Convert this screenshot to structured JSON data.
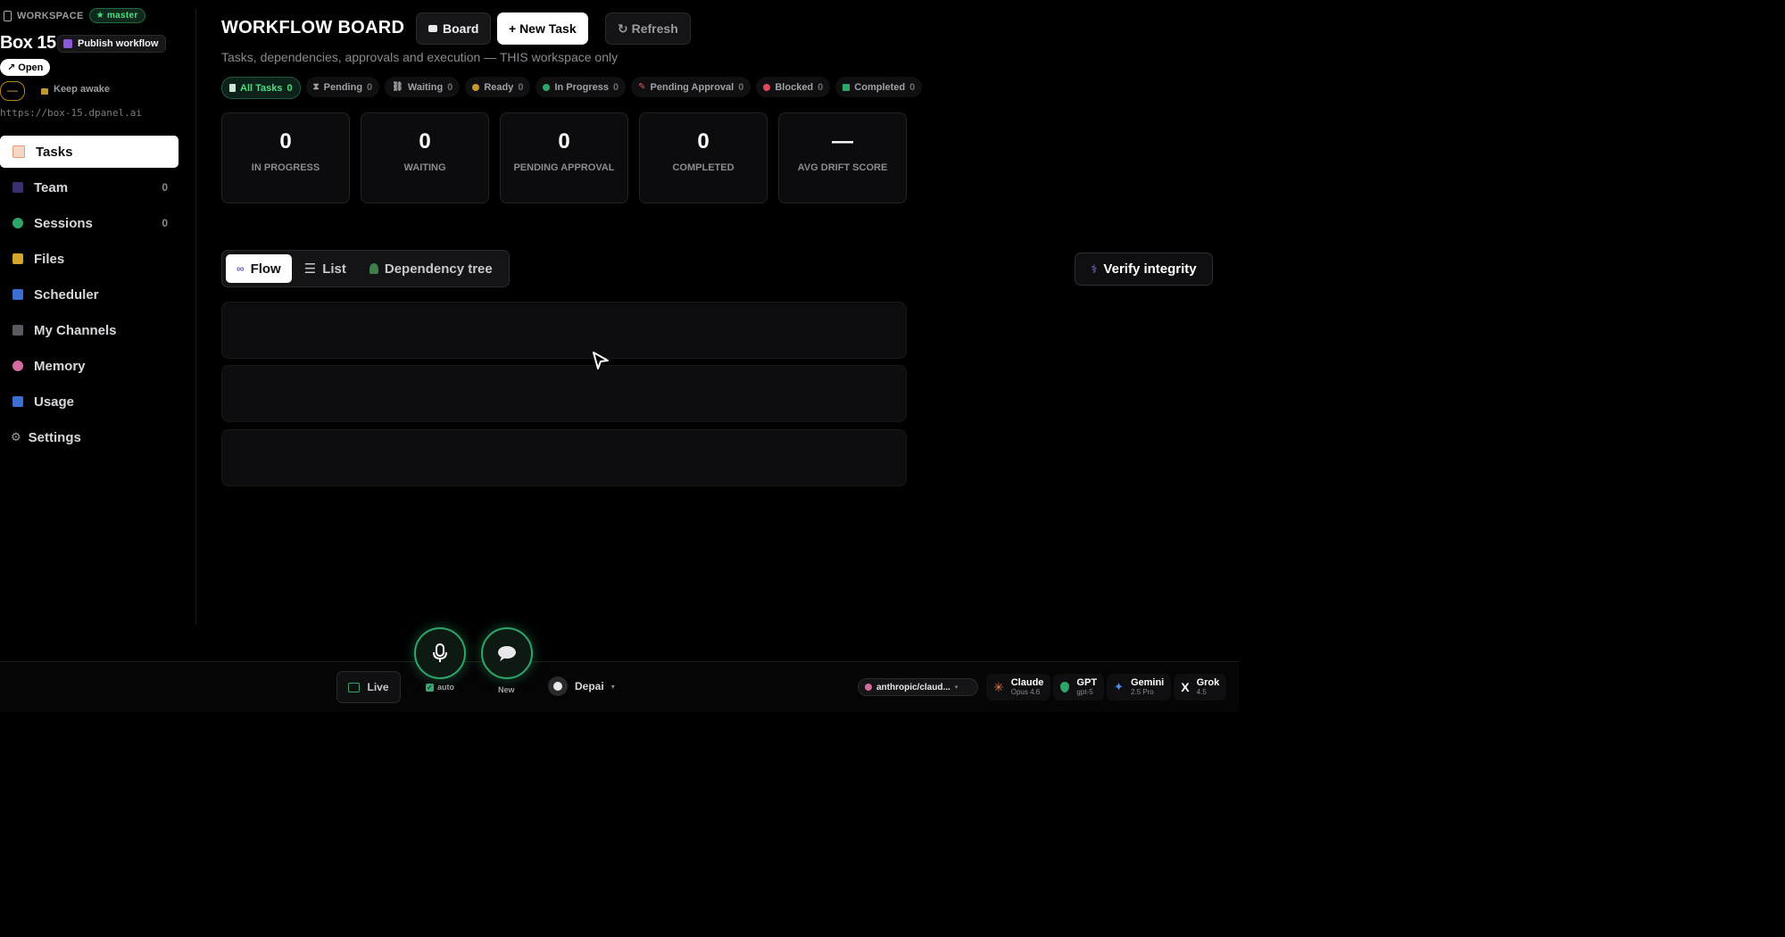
{
  "workspace": {
    "label": "WORKSPACE",
    "branch": "★ master",
    "box_name": "Box 15",
    "publish_label": "Publish workflow",
    "open_label": "↗ Open",
    "dash_label": "—",
    "keep_awake_label": "Keep awake",
    "url": "https://box-15.dpanel.ai"
  },
  "sidebar": {
    "items": [
      {
        "label": "Tasks",
        "count": "",
        "icon": "clipboard-icon",
        "color": "#e89a6a"
      },
      {
        "label": "Team",
        "count": "0",
        "icon": "people-icon",
        "color": "#6b5bc4"
      },
      {
        "label": "Sessions",
        "count": "0",
        "icon": "green-circle-icon",
        "color": "#2ea66a"
      },
      {
        "label": "Files",
        "count": "",
        "icon": "folder-icon",
        "color": "#d4a52a"
      },
      {
        "label": "Scheduler",
        "count": "",
        "icon": "calendar-icon",
        "color": "#3b6fd4"
      },
      {
        "label": "My Channels",
        "count": "",
        "icon": "satellite-icon",
        "color": "#8a8a90"
      },
      {
        "label": "Memory",
        "count": "",
        "icon": "brain-icon",
        "color": "#d46aa0"
      },
      {
        "label": "Usage",
        "count": "",
        "icon": "bar-chart-icon",
        "color": "#3b6fd4"
      },
      {
        "label": "Settings",
        "count": "",
        "icon": "gear-icon",
        "color": "#a0a0a6"
      }
    ]
  },
  "header": {
    "title": "WORKFLOW BOARD",
    "board_label": "Board",
    "new_task_label": "+ New Task",
    "refresh_label": "↻ Refresh",
    "subtitle": "Tasks, dependencies, approvals and execution — THIS workspace only"
  },
  "filters": [
    {
      "label": "All Tasks",
      "count": "0",
      "icon": "clipboard-icon",
      "color": "#4ade80"
    },
    {
      "label": "Pending",
      "count": "0",
      "icon": "hourglass-icon",
      "color": "#a0a0a6"
    },
    {
      "label": "Waiting",
      "count": "0",
      "icon": "link-icon",
      "color": "#a0a0a6"
    },
    {
      "label": "Ready",
      "count": "0",
      "icon": "yellow-circle-icon",
      "color": "#d4a52a"
    },
    {
      "label": "In Progress",
      "count": "0",
      "icon": "green-circle-icon",
      "color": "#2ea66a"
    },
    {
      "label": "Pending Approval",
      "count": "0",
      "icon": "pin-icon",
      "color": "#e05a5a"
    },
    {
      "label": "Blocked",
      "count": "0",
      "icon": "no-entry-icon",
      "color": "#e04a5a"
    },
    {
      "label": "Completed",
      "count": "0",
      "icon": "check-box-icon",
      "color": "#2ea66a"
    }
  ],
  "stats": [
    {
      "value": "0",
      "label": "IN PROGRESS"
    },
    {
      "value": "0",
      "label": "WAITING"
    },
    {
      "value": "0",
      "label": "PENDING APPROVAL"
    },
    {
      "value": "0",
      "label": "COMPLETED"
    },
    {
      "value": "—",
      "label": "AVG DRIFT SCORE"
    }
  ],
  "views": {
    "tabs": [
      {
        "label": "Flow",
        "icon": "flow-icon"
      },
      {
        "label": "List",
        "icon": "list-icon"
      },
      {
        "label": "Dependency tree",
        "icon": "tree-icon"
      }
    ],
    "verify_label": "Verify integrity"
  },
  "bottom": {
    "live_label": "Live",
    "auto_label": "auto",
    "new_label": "New",
    "persona_label": "Depai",
    "model_label": "anthropic/claud...",
    "providers": [
      {
        "name": "Claude",
        "sub": "Opus 4.6",
        "color": "#e07a4a"
      },
      {
        "name": "GPT",
        "sub": "gpt-5",
        "color": "#2ea66a"
      },
      {
        "name": "Gemini",
        "sub": "2.5 Pro",
        "color": "#4a8af0"
      },
      {
        "name": "Grok",
        "sub": "4.5",
        "color": "#ffffff"
      }
    ]
  }
}
